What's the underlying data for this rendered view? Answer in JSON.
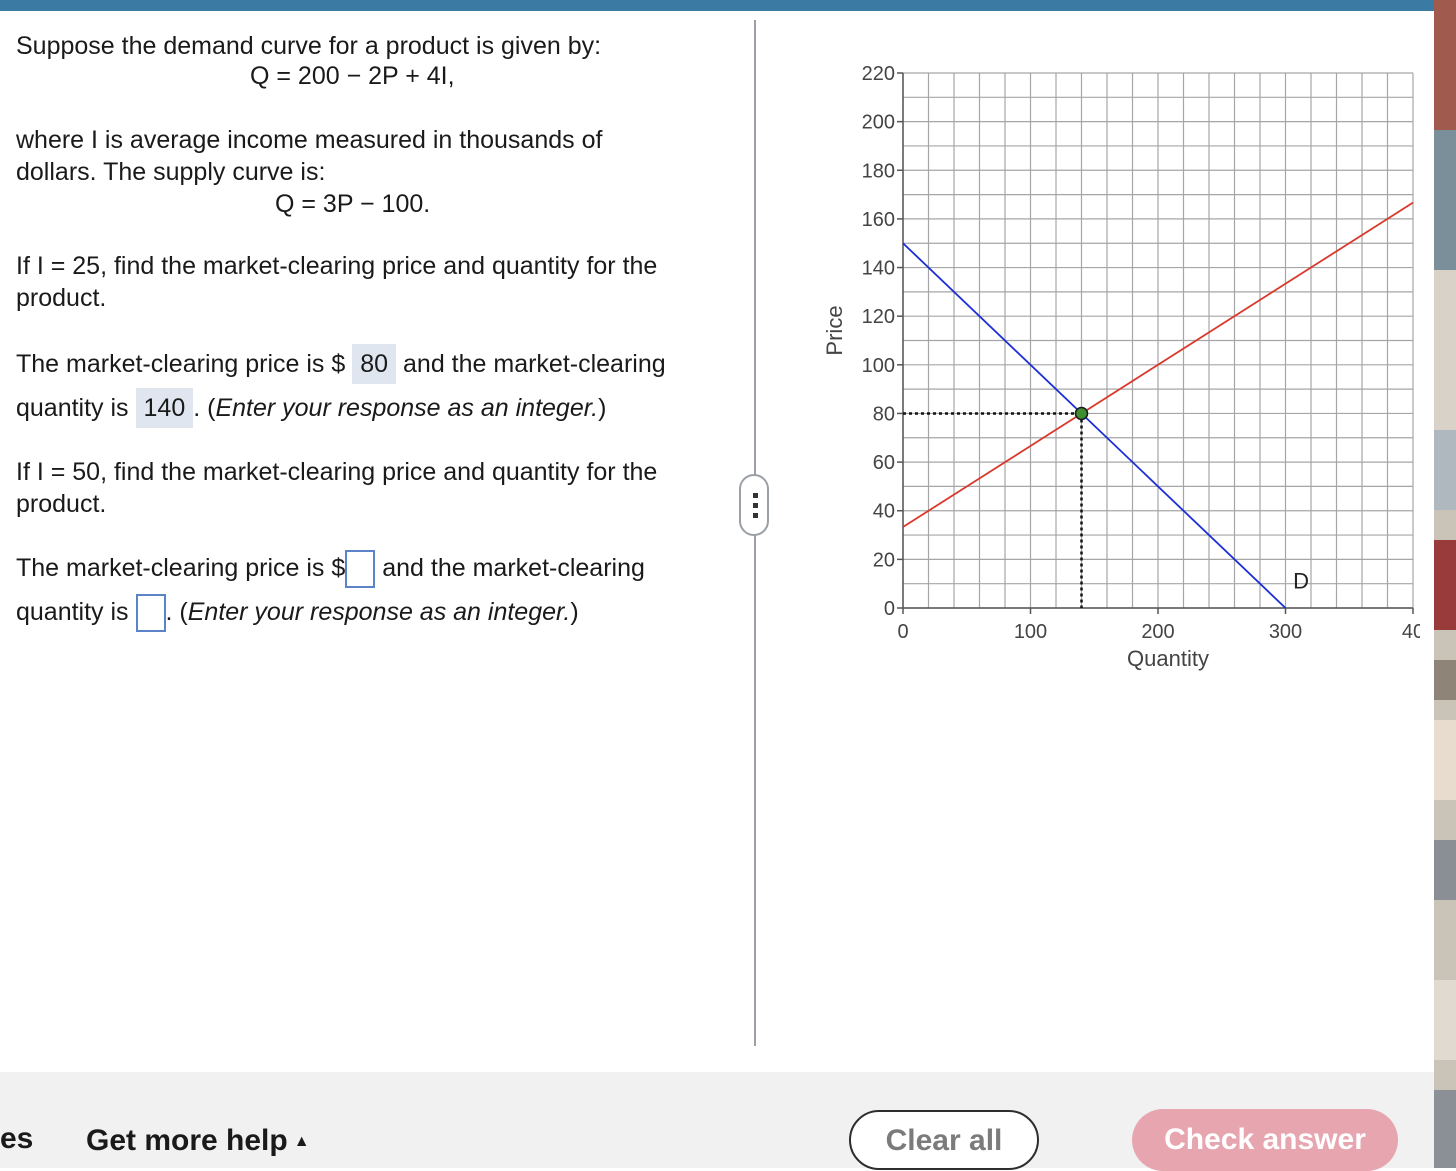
{
  "question": {
    "intro": "Suppose the demand curve for a product is given by:",
    "demand_eq": "Q = 200 − 2P + 4I,",
    "income_note_1": "where I is average income measured in thousands of",
    "income_note_2": "dollars. The supply curve is:",
    "supply_eq": "Q = 3P − 100.",
    "part1_q1": "If I = 25, find the market-clearing price and quantity for the",
    "part1_q2": "product.",
    "part1_a_pre": "The market-clearing price is $",
    "part1_price": "80",
    "part1_a_mid": "and the market-clearing",
    "part1_a_qty_pre": "quantity is",
    "part1_qty": "140",
    "part1_a_post": ". (",
    "instruction": "Enter your response as an integer.",
    "close_paren": ")",
    "part2_q1": "If I = 50, find the market-clearing price and quantity for the",
    "part2_q2": "product.",
    "part2_a_pre": "The market-clearing price is $",
    "part2_price": "",
    "part2_a_mid": "and the market-clearing",
    "part2_a_qty_pre": "quantity is",
    "part2_qty": "",
    "part2_a_post": ". ("
  },
  "chart_data": {
    "type": "line",
    "xlabel": "Quantity",
    "ylabel": "Price",
    "xlim": [
      0,
      400
    ],
    "ylim": [
      0,
      220
    ],
    "x_ticks": [
      0,
      100,
      200,
      300,
      400
    ],
    "x_tick_labels": [
      "0",
      "100",
      "200",
      "300",
      "40"
    ],
    "y_ticks": [
      0,
      20,
      40,
      60,
      80,
      100,
      120,
      140,
      160,
      180,
      200,
      220
    ],
    "y_tick_labels": [
      "0",
      "20",
      "40",
      "60",
      "80",
      "100",
      "120",
      "140",
      "160",
      "180",
      "200",
      "220"
    ],
    "grid": true,
    "series": [
      {
        "name": "D",
        "color": "#1c2fd6",
        "x": [
          0,
          300
        ],
        "y": [
          150,
          0
        ]
      },
      {
        "name": "",
        "color": "#d9392b",
        "x": [
          0,
          400
        ],
        "y": [
          33.3,
          166.7
        ]
      }
    ],
    "equilibrium": {
      "x": 140,
      "y": 80,
      "color": "#3e8e2f"
    },
    "labels": [
      {
        "text": "D",
        "x": 306,
        "y": 8
      }
    ]
  },
  "footer": {
    "left_fragment": "es",
    "help_label": "Get more help",
    "help_icon": "triangle-up-icon",
    "clear_label": "Clear all",
    "check_label": "Check answer"
  },
  "colors": {
    "topbar": "#3a7aa3",
    "check_button": "#e7a5b0",
    "answer_highlight": "#dfe6ef",
    "input_border": "#5a84c7"
  }
}
